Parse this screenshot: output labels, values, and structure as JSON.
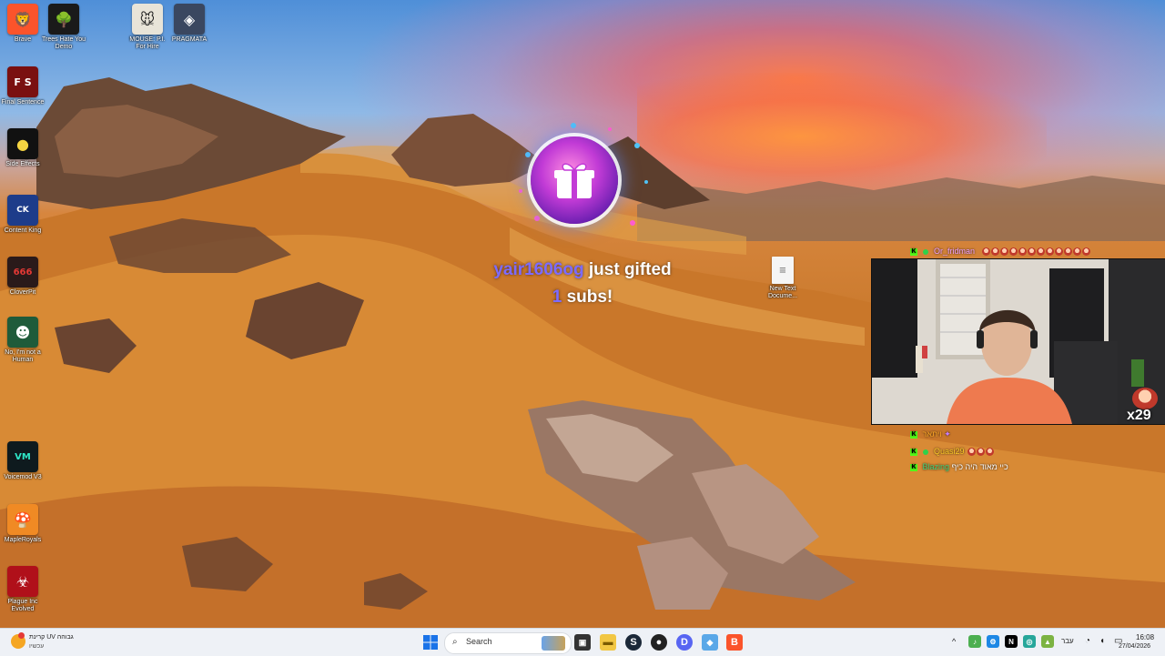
{
  "desktop": {
    "icons": [
      {
        "label": "Brave",
        "icon": "brave-icon"
      },
      {
        "label": "Trees Hate You Demo",
        "icon": "tree-icon"
      },
      {
        "label": "MOUSE: P.I. For Hire",
        "icon": "mouse-game-icon"
      },
      {
        "label": "PRAGMATA",
        "icon": "pragmata-icon"
      },
      {
        "label": "Final Sentence",
        "icon": "final-sentence-icon"
      },
      {
        "label": "Side Effects",
        "icon": "side-effects-icon"
      },
      {
        "label": "Content King",
        "icon": "content-king-icon"
      },
      {
        "label": "CloverPit",
        "icon": "cloverpit-icon"
      },
      {
        "label": "No, I'm not a Human",
        "icon": "not-human-icon"
      },
      {
        "label": "Voicemod V3",
        "icon": "voicemod-icon"
      },
      {
        "label": "MapleRoyals",
        "icon": "mapleroyals-icon"
      },
      {
        "label": "Plague Inc Evolved",
        "icon": "plague-icon"
      },
      {
        "label": "New Text Docume...",
        "icon": "text-document-icon"
      }
    ]
  },
  "alert": {
    "username": "yair1606og",
    "action": "just gifted",
    "count": "1",
    "suffix": "subs!"
  },
  "overlay": {
    "top_chat": {
      "user": "Or_fridman",
      "emote_count": "12"
    },
    "sub_counter": "x29",
    "chat": [
      {
        "user": "ויתאר",
        "text": ""
      },
      {
        "user": "Quasi29",
        "text": ""
      },
      {
        "user": "Blazing",
        "text": "כיי מאוד היה כיף"
      }
    ]
  },
  "taskbar": {
    "weather_title": "קרינת UV גבוהה",
    "weather_sub": "עכשיו",
    "search_placeholder": "Search",
    "language": "עבר",
    "time": "16:08",
    "date": "27/04/2026"
  },
  "colors": {
    "accent_purple": "#7d6bff",
    "kick_green": "#53fc18",
    "taskbar_bg": "#eef1f6"
  }
}
